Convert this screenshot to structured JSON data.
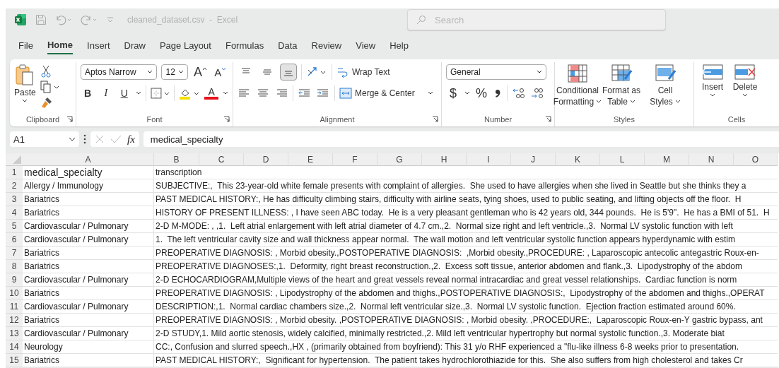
{
  "window": {
    "title": "cleaned_dataset.csv  -  Excel"
  },
  "search": {
    "placeholder": "Search"
  },
  "menu_tabs": [
    {
      "label": "File",
      "selected": false
    },
    {
      "label": "Home",
      "selected": true
    },
    {
      "label": "Insert",
      "selected": false
    },
    {
      "label": "Draw",
      "selected": false
    },
    {
      "label": "Page Layout",
      "selected": false
    },
    {
      "label": "Formulas",
      "selected": false
    },
    {
      "label": "Data",
      "selected": false
    },
    {
      "label": "Review",
      "selected": false
    },
    {
      "label": "View",
      "selected": false
    },
    {
      "label": "Help",
      "selected": false
    }
  ],
  "ribbon": {
    "clipboard": {
      "label": "Clipboard",
      "paste": "Paste"
    },
    "font": {
      "label": "Font",
      "font_name": "Aptos Narrow",
      "font_size": "12",
      "grow": "A",
      "shrink": "A",
      "bold": "B",
      "italic": "I",
      "underline": "U",
      "font_color": "A"
    },
    "alignment": {
      "label": "Alignment",
      "vertical_align": [
        {
          "kind": "top",
          "selected": false
        },
        {
          "kind": "middle",
          "selected": false
        },
        {
          "kind": "bottom",
          "selected": true
        }
      ],
      "wrap_text": "Wrap Text",
      "merge_center": "Merge & Center"
    },
    "number": {
      "label": "Number",
      "format": "General",
      "currency": "$",
      "percent": "%"
    },
    "styles": {
      "label": "Styles",
      "buttons": [
        {
          "kind": "conditional",
          "lines": [
            "Conditional",
            "Formatting"
          ]
        },
        {
          "kind": "table",
          "lines": [
            "Format as",
            "Table"
          ]
        },
        {
          "kind": "cell",
          "lines": [
            "Cell",
            "Styles"
          ]
        }
      ]
    },
    "cells": {
      "label": "Cells",
      "buttons": [
        {
          "kind": "insert",
          "label": "Insert"
        },
        {
          "kind": "delete",
          "label": "Delete"
        }
      ]
    }
  },
  "formula_bar": {
    "name_box": "A1",
    "fx": "fx",
    "value": "medical_specialty"
  },
  "sheet": {
    "columns": [
      "A",
      "B",
      "C",
      "D",
      "E",
      "F",
      "G",
      "H",
      "I",
      "J",
      "K",
      "L",
      "M",
      "N",
      "O"
    ],
    "rows": [
      {
        "number": "1",
        "cells": [
          "medical_specialty",
          "transcription"
        ]
      },
      {
        "number": "2",
        "cells": [
          "Allergy / Immunology",
          "SUBJECTIVE:,  This 23-year-old white female presents with complaint of allergies.  She used to have allergies when she lived in Seattle but she thinks they a"
        ]
      },
      {
        "number": "3",
        "cells": [
          "Bariatrics",
          "PAST MEDICAL HISTORY:, He has difficulty climbing stairs, difficulty with airline seats, tying shoes, used to public seating, and lifting objects off the floor.  H"
        ]
      },
      {
        "number": "4",
        "cells": [
          "Bariatrics",
          "HISTORY OF PRESENT ILLNESS: , I have seen ABC today.  He is a very pleasant gentleman who is 42 years old, 344 pounds.  He is 5'9\".  He has a BMI of 51.  H"
        ]
      },
      {
        "number": "5",
        "cells": [
          "Cardiovascular / Pulmonary",
          "2-D M-MODE: , ,1.  Left atrial enlargement with left atrial diameter of 4.7 cm.,2.  Normal size right and left ventricle.,3.  Normal LV systolic function with left"
        ]
      },
      {
        "number": "6",
        "cells": [
          "Cardiovascular / Pulmonary",
          "1.  The left ventricular cavity size and wall thickness appear normal.  The wall motion and left ventricular systolic function appears hyperdynamic with estim"
        ]
      },
      {
        "number": "7",
        "cells": [
          "Bariatrics",
          "PREOPERATIVE DIAGNOSIS: , Morbid obesity.,POSTOPERATIVE DIAGNOSIS:  ,Morbid obesity.,PROCEDURE: , Laparoscopic antecolic antegastric Roux-en-"
        ]
      },
      {
        "number": "8",
        "cells": [
          "Bariatrics",
          "PREOPERATIVE DIAGNOSES:,1.  Deformity, right breast reconstruction.,2.  Excess soft tissue, anterior abdomen and flank.,3.  Lipodystrophy of the abdom"
        ]
      },
      {
        "number": "9",
        "cells": [
          "Cardiovascular / Pulmonary",
          "2-D ECHOCARDIOGRAM,Multiple views of the heart and great vessels reveal normal intracardiac and great vessel relationships.  Cardiac function is norm"
        ]
      },
      {
        "number": "10",
        "cells": [
          "Bariatrics",
          "PREOPERATIVE DIAGNOSIS: , Lipodystrophy of the abdomen and thighs.,POSTOPERATIVE DIAGNOSIS:,  Lipodystrophy of the abdomen and thighs.,OPERAT"
        ]
      },
      {
        "number": "11",
        "cells": [
          "Cardiovascular / Pulmonary",
          "DESCRIPTION:,1.  Normal cardiac chambers size.,2.  Normal left ventricular size.,3.  Normal LV systolic function.  Ejection fraction estimated around 60%."
        ]
      },
      {
        "number": "12",
        "cells": [
          "Bariatrics",
          "PREOPERATIVE DIAGNOSIS: , Morbid obesity. ,POSTOPERATIVE DIAGNOSIS: , Morbid obesity. ,PROCEDURE:,  Laparoscopic Roux-en-Y gastric bypass, ant"
        ]
      },
      {
        "number": "13",
        "cells": [
          "Cardiovascular / Pulmonary",
          "2-D STUDY,1. Mild aortic stenosis, widely calcified, minimally restricted.,2. Mild left ventricular hypertrophy but normal systolic function.,3. Moderate biat"
        ]
      },
      {
        "number": "14",
        "cells": [
          "Neurology",
          "CC:, Confusion and slurred speech.,HX , (primarily obtained from boyfriend): This 31 y/o RHF experienced a \"flu-like illness 6-8 weeks prior to presentation."
        ]
      },
      {
        "number": "15",
        "cells": [
          "Bariatrics",
          "PAST MEDICAL HISTORY:,  Significant for hypertension.  The patient takes hydrochlorothiazide for this.  She also suffers from high cholesterol and takes Cr"
        ]
      }
    ]
  }
}
